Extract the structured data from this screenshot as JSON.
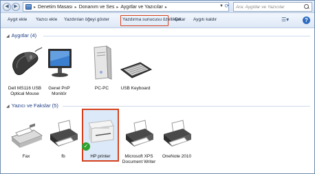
{
  "address": {
    "crumbs": [
      "Denetim Masası",
      "Donanım ve Ses",
      "Aygıtlar ve Yazıcılar"
    ],
    "search_placeholder": "Ara: Aygıtlar ve Yazıcılar"
  },
  "toolbar": {
    "add_device": "Aygıt ekle",
    "add_printer": "Yazıcı ekle",
    "print_queue": "Yazdırılan öğeyi göster",
    "server_props": "Yazdırma sunucusu özellikleri",
    "eject": "Çıkar",
    "remove_device": "Aygıtı kaldır"
  },
  "groups": {
    "devices": {
      "title": "Aygıtlar (4)",
      "items": [
        {
          "label_1": "Dell MS116 USB",
          "label_2": "Optical Mouse",
          "icon": "mouse-icon"
        },
        {
          "label_1": "Genel PnP",
          "label_2": "Monitör",
          "icon": "monitor-icon"
        },
        {
          "label_1": "PC-PC",
          "label_2": "",
          "icon": "computer-icon"
        },
        {
          "label_1": "USB Keyboard",
          "label_2": "",
          "icon": "keyboard-icon"
        }
      ]
    },
    "printers": {
      "title": "Yazıcı ve Fakslar (5)",
      "items": [
        {
          "label_1": "Fax",
          "label_2": "",
          "icon": "fax-icon"
        },
        {
          "label_1": "fb",
          "label_2": "",
          "icon": "printer-icon"
        },
        {
          "label_1": "HP printer",
          "label_2": "",
          "icon": "printer-icon",
          "default": true
        },
        {
          "label_1": "Microsoft XPS",
          "label_2": "Document Writer",
          "icon": "printer-icon"
        },
        {
          "label_1": "OneNote 2010",
          "label_2": "",
          "icon": "printer-icon"
        }
      ]
    }
  },
  "colors": {
    "highlight": "#d4401c",
    "group_heading": "#1e3d84",
    "default_check": "#2fa12f"
  }
}
